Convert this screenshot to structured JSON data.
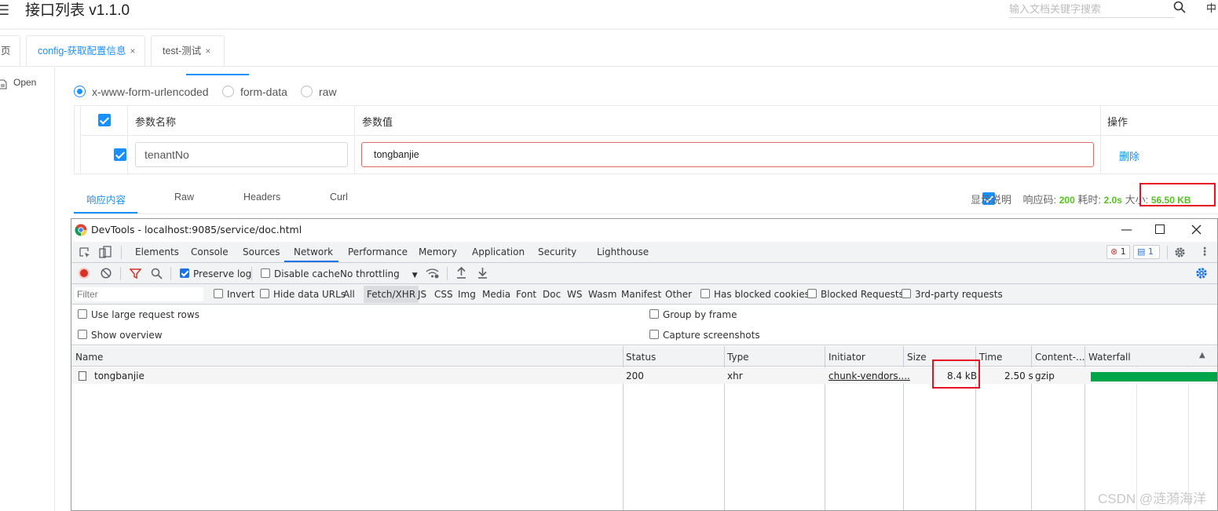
{
  "header": {
    "menu_icon": "hamburger-menu-icon",
    "title": "接口列表 v1.1.0",
    "search_placeholder": "输入文档关键字搜索",
    "lang": "中"
  },
  "tabs": [
    {
      "label": "主页",
      "visible_label": "页"
    },
    {
      "label": "config-获取配置信息",
      "close": "×"
    },
    {
      "label": "test-测试",
      "close": "×"
    }
  ],
  "sidebar": {
    "open_label": "Open"
  },
  "body_types": [
    {
      "label": "x-www-form-urlencoded",
      "selected": true
    },
    {
      "label": "form-data",
      "selected": false
    },
    {
      "label": "raw",
      "selected": false
    }
  ],
  "params": {
    "headers": {
      "name": "参数名称",
      "value": "参数值",
      "action": "操作"
    },
    "rows": [
      {
        "checked": true,
        "name": "tenantNo",
        "value": "tongbanjie",
        "action": "删除"
      }
    ]
  },
  "response_tabs": [
    "响应内容",
    "Raw",
    "Headers",
    "Curl"
  ],
  "response_meta": {
    "show_desc": "显示说明",
    "status_label": "响应码:",
    "status": "200",
    "time_label": "耗时:",
    "time": "2.0s",
    "size_label": "大小:",
    "size": "56.50 KB"
  },
  "devtools": {
    "title": "DevTools - localhost:9085/service/doc.html",
    "tabs": [
      "Elements",
      "Console",
      "Sources",
      "Network",
      "Performance",
      "Memory",
      "Application",
      "Security",
      "Lighthouse"
    ],
    "active_tab": "Network",
    "errors": "1",
    "messages": "1",
    "toolbar": {
      "preserve_log": "Preserve log",
      "disable_cache": "Disable cache",
      "throttling": "No throttling"
    },
    "filter": {
      "placeholder": "Filter",
      "invert": "Invert",
      "hide_data_urls": "Hide data URLs",
      "types": [
        "All",
        "Fetch/XHR",
        "JS",
        "CSS",
        "Img",
        "Media",
        "Font",
        "Doc",
        "WS",
        "Wasm",
        "Manifest",
        "Other"
      ],
      "has_blocked_cookies": "Has blocked cookies",
      "blocked_requests": "Blocked Requests",
      "third_party": "3rd-party requests"
    },
    "settings": {
      "large_rows": "Use large request rows",
      "show_overview": "Show overview",
      "group_by_frame": "Group by frame",
      "capture_screenshots": "Capture screenshots"
    },
    "columns": [
      "Name",
      "Status",
      "Type",
      "Initiator",
      "Size",
      "Time",
      "Content-...",
      "Waterfall"
    ],
    "requests": [
      {
        "name": "tongbanjie",
        "status": "200",
        "type": "xhr",
        "initiator": "chunk-vendors....",
        "size": "8.4 kB",
        "time": "2.50 s",
        "content": "gzip"
      }
    ]
  },
  "watermark": "CSDN @涟漪海洋"
}
